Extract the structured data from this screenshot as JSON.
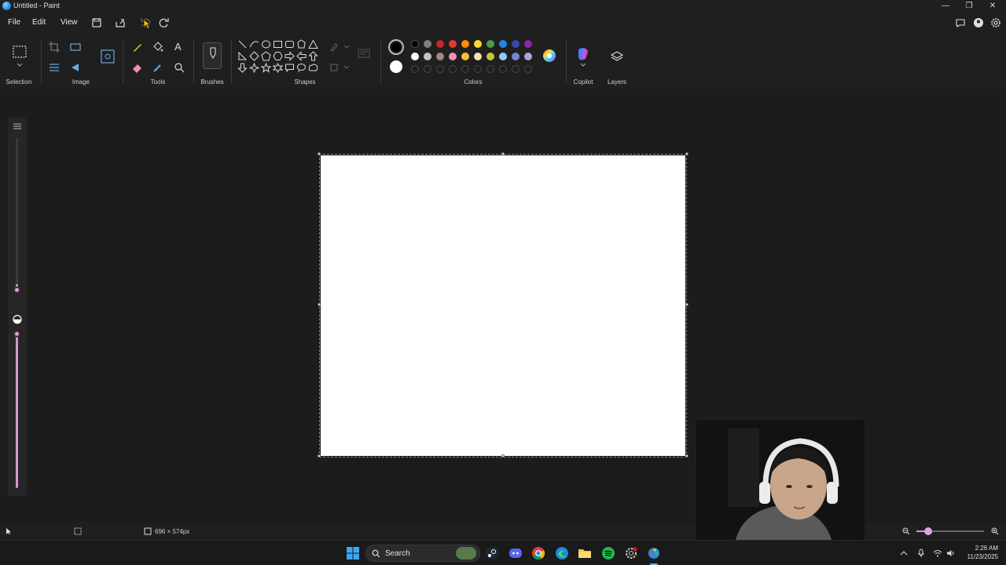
{
  "window": {
    "title": "Untitled - Paint",
    "controls": [
      "—",
      "❐",
      "✕"
    ]
  },
  "menu": {
    "items": [
      "File",
      "Edit",
      "View"
    ]
  },
  "ribbon": {
    "groups": {
      "selection": "Selection",
      "image": "Image",
      "tools": "Tools",
      "brushes": "Brushes",
      "shapes": "Shapes",
      "colors": "Colors",
      "copilot": "Copilot",
      "layers": "Layers"
    },
    "palette_row1": [
      "#000000",
      "#7f7f7f",
      "#c62828",
      "#e53935",
      "#fb8c00",
      "#fdd835",
      "#43a047",
      "#1e88e5",
      "#3949ab",
      "#8e24aa"
    ],
    "palette_row2": [
      "#ffffff",
      "#c3c3c3",
      "#a1887f",
      "#f48fb1",
      "#fbc02d",
      "#f5deb3",
      "#c0ca33",
      "#90caf9",
      "#7986cb",
      "#b39ddb"
    ],
    "primary_color": "#000000",
    "secondary_color": "#ffffff"
  },
  "status": {
    "canvas_size": "696 × 574px"
  },
  "taskbar": {
    "search_label": "Search",
    "time": "2:26 AM",
    "date": "11/23/2025"
  }
}
